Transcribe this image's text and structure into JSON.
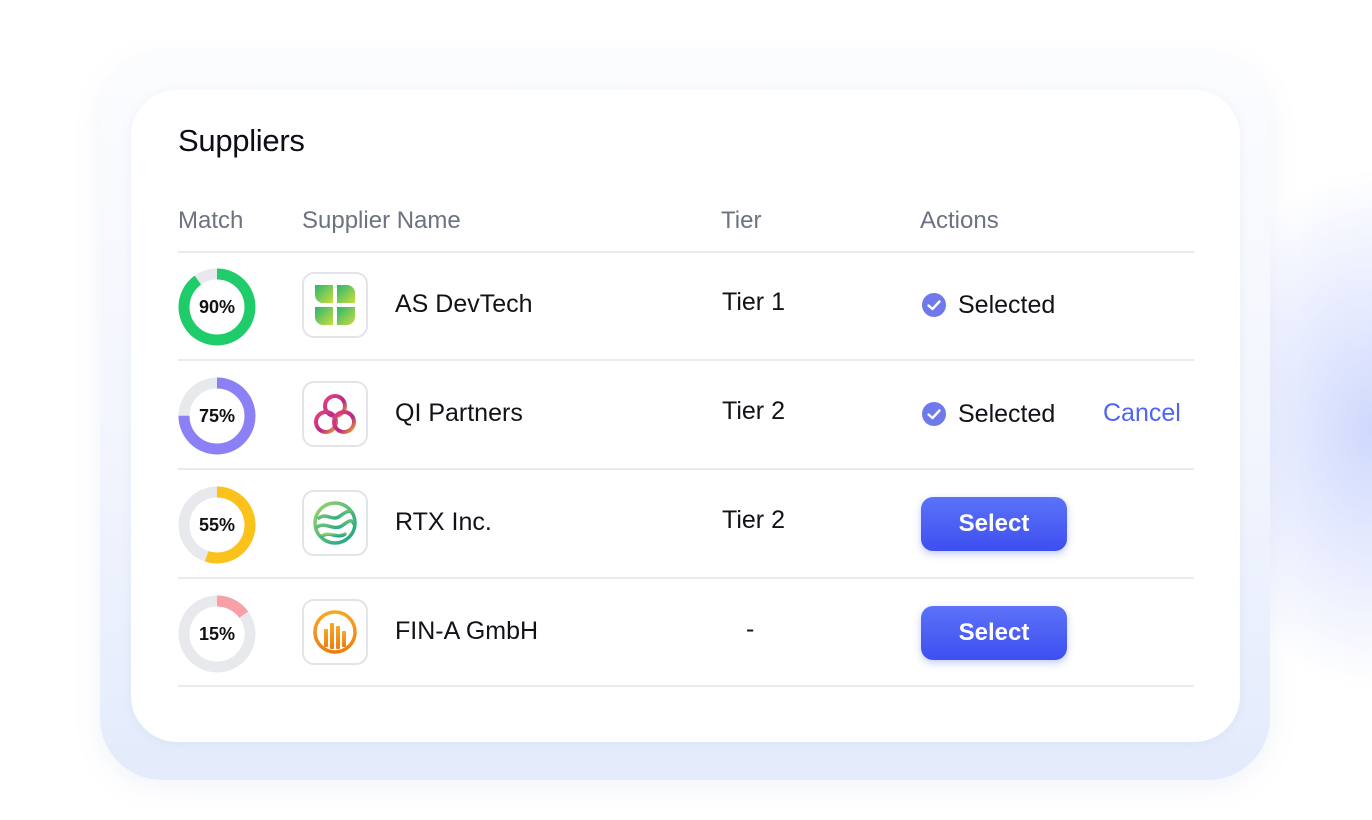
{
  "panel": {
    "title": "Suppliers"
  },
  "columns": {
    "match": "Match",
    "supplier_name": "Supplier Name",
    "tier": "Tier",
    "actions": "Actions"
  },
  "suppliers": [
    {
      "match_label": "90%",
      "match_value": 0.9,
      "ring_color": "#1fcc6a",
      "name": "AS DevTech",
      "logo_icon": "green-leaves-logo",
      "tier": "Tier 1",
      "status": "Selected"
    },
    {
      "match_label": "75%",
      "match_value": 0.75,
      "ring_color": "#8c80f7",
      "name": "QI Partners",
      "logo_icon": "interlocked-rings-logo",
      "tier": "Tier 2",
      "status": "Selected",
      "cancel_label": "Cancel"
    },
    {
      "match_label": "55%",
      "match_value": 0.55,
      "ring_color": "#fbc21c",
      "name": "RTX Inc.",
      "logo_icon": "green-globe-logo",
      "tier": "Tier 2",
      "button_label": "Select"
    },
    {
      "match_label": "15%",
      "match_value": 0.15,
      "ring_color": "#f7a0a6",
      "name": "FIN-A GmbH",
      "logo_icon": "orange-bars-logo",
      "tier": "-",
      "button_label": "Select"
    }
  ],
  "colors": {
    "accent": "#4658f2",
    "check": "#6f79ec",
    "ring_track": "#e8e9ed"
  }
}
